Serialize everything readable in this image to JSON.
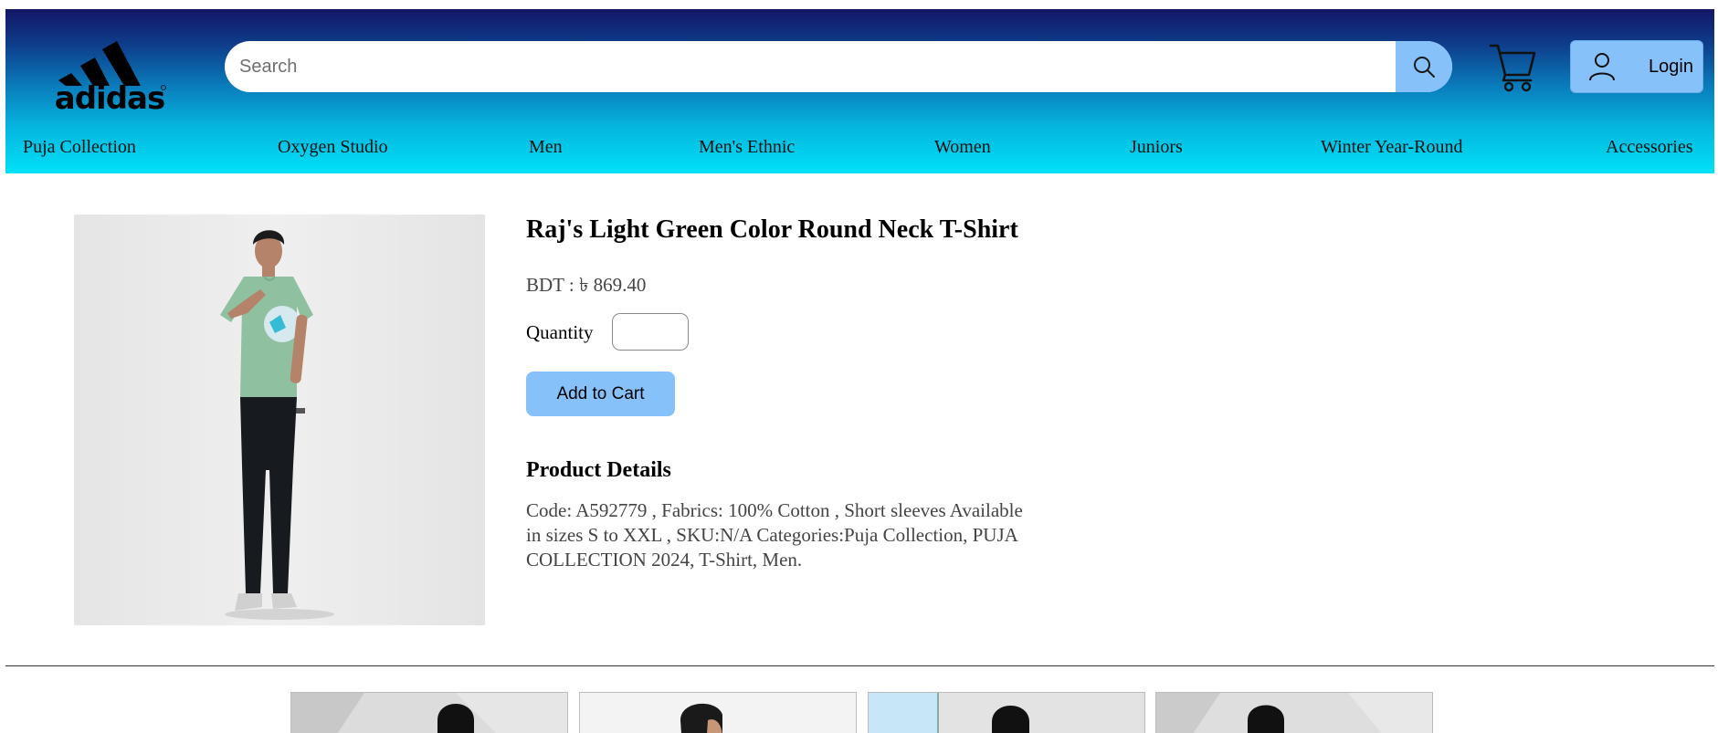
{
  "header": {
    "logo_text": "adidas",
    "search": {
      "placeholder": "Search",
      "value": ""
    },
    "search_icon": "magnifier-icon",
    "cart_icon": "shopping-cart-icon",
    "login": {
      "icon": "user-icon",
      "label": "Login"
    }
  },
  "nav": {
    "items": [
      "Puja Collection",
      "Oxygen Studio",
      "Men",
      "Men's Ethnic",
      "Women",
      "Juniors",
      "Winter Year-Round",
      "Accessories"
    ]
  },
  "product": {
    "title": "Raj's Light Green Color Round Neck T-Shirt",
    "price": "BDT : ৳ 869.40",
    "quantity_label": "Quantity",
    "quantity_value": "",
    "add_to_cart": "Add to Cart",
    "details_heading": "Product Details",
    "details_text": "Code: A592779 , Fabrics: 100% Cotton , Short sleeves Available in sizes S to XXL , SKU:N/A Categories:Puja Collection, PUJA COLLECTION 2024, T-Shirt, Men."
  },
  "related_products": [
    {
      "name": "related-product-1"
    },
    {
      "name": "related-product-2"
    },
    {
      "name": "related-product-3"
    },
    {
      "name": "related-product-4"
    }
  ],
  "colors": {
    "header_top": "#141566",
    "header_bottom": "#00e1f7",
    "accent_button": "#86c1fa",
    "shirt_green": "#8fc0a0"
  }
}
